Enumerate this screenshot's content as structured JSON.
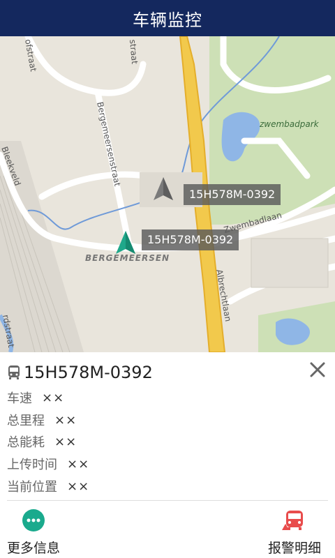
{
  "title": "车辆监控",
  "map": {
    "labels": {
      "straat_top_left": "ofstraat",
      "straat_top": "straat",
      "bergemeersenstraat": "Bergemeersenstraat",
      "bleekveld": "Bleekveld",
      "zwembadpark": "zwembadpark",
      "zwembadlaan": "Zwembadlaan",
      "bergemeersen": "BERGEMEERSEN",
      "albrechtlaan": "Albrechtlaan",
      "straat_bottom_left": "rdstraat"
    },
    "vehicles": [
      {
        "plate": "15H578M-0392",
        "color": "#7a7a7a"
      },
      {
        "plate": "15H578M-0392",
        "color": "#1fa88a"
      }
    ]
  },
  "panel": {
    "plate": "15H578M-0392",
    "fields": [
      {
        "label": "车速",
        "value": "××"
      },
      {
        "label": "总里程",
        "value": "××"
      },
      {
        "label": "总能耗",
        "value": "××"
      },
      {
        "label": "上传时间",
        "value": "××"
      },
      {
        "label": "当前位置",
        "value": "××"
      }
    ],
    "more_label": "更多信息",
    "alarm_label": "报警明细"
  },
  "colors": {
    "titlebar": "#14285e",
    "more_button": "#1aaa8d",
    "alarm_icon": "#e84c4c"
  }
}
